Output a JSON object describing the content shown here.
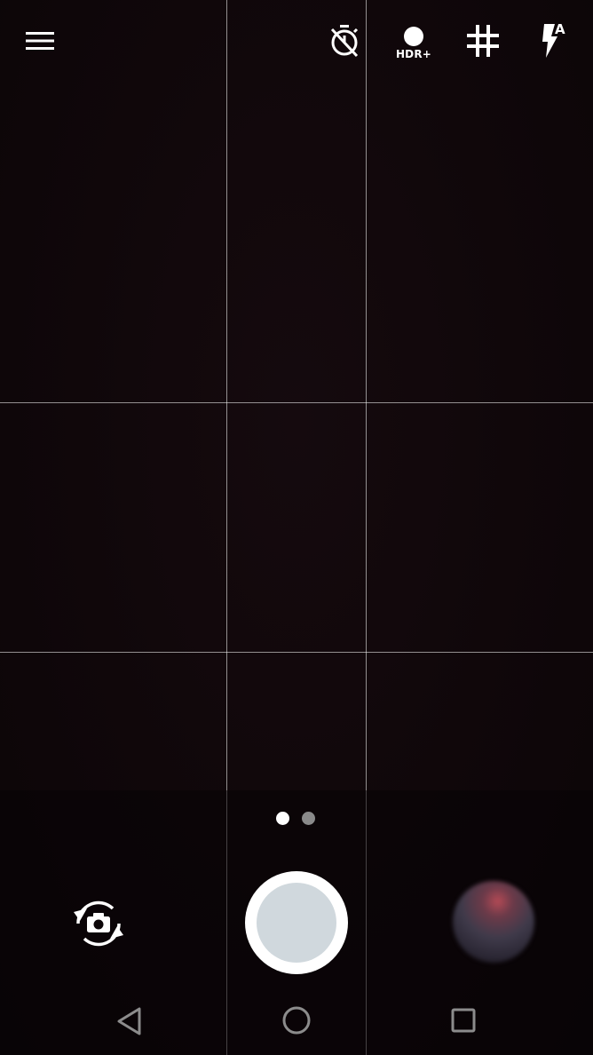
{
  "top_controls": {
    "menu_icon": "hamburger-menu-icon",
    "timer_icon": "timer-off-icon",
    "hdr_icon": "hdr-plus-icon",
    "hdr_label": "HDR+",
    "grid_icon": "grid-icon",
    "flash_icon": "flash-auto-icon",
    "flash_label": "A"
  },
  "mode_pager": {
    "pages": 2,
    "active_index": 0,
    "active_color": "#ffffff",
    "inactive_color": "#8a8a8a"
  },
  "bottom_controls": {
    "switch_camera_icon": "switch-camera-icon",
    "shutter_icon": "shutter-button",
    "gallery_icon": "gallery-thumbnail"
  },
  "navigation": {
    "back_icon": "back-icon",
    "home_icon": "home-icon",
    "recents_icon": "recents-icon"
  },
  "colors": {
    "viewfinder": "#0f070a",
    "shutter_outer": "#ffffff",
    "shutter_inner": "#d0d8dd"
  }
}
